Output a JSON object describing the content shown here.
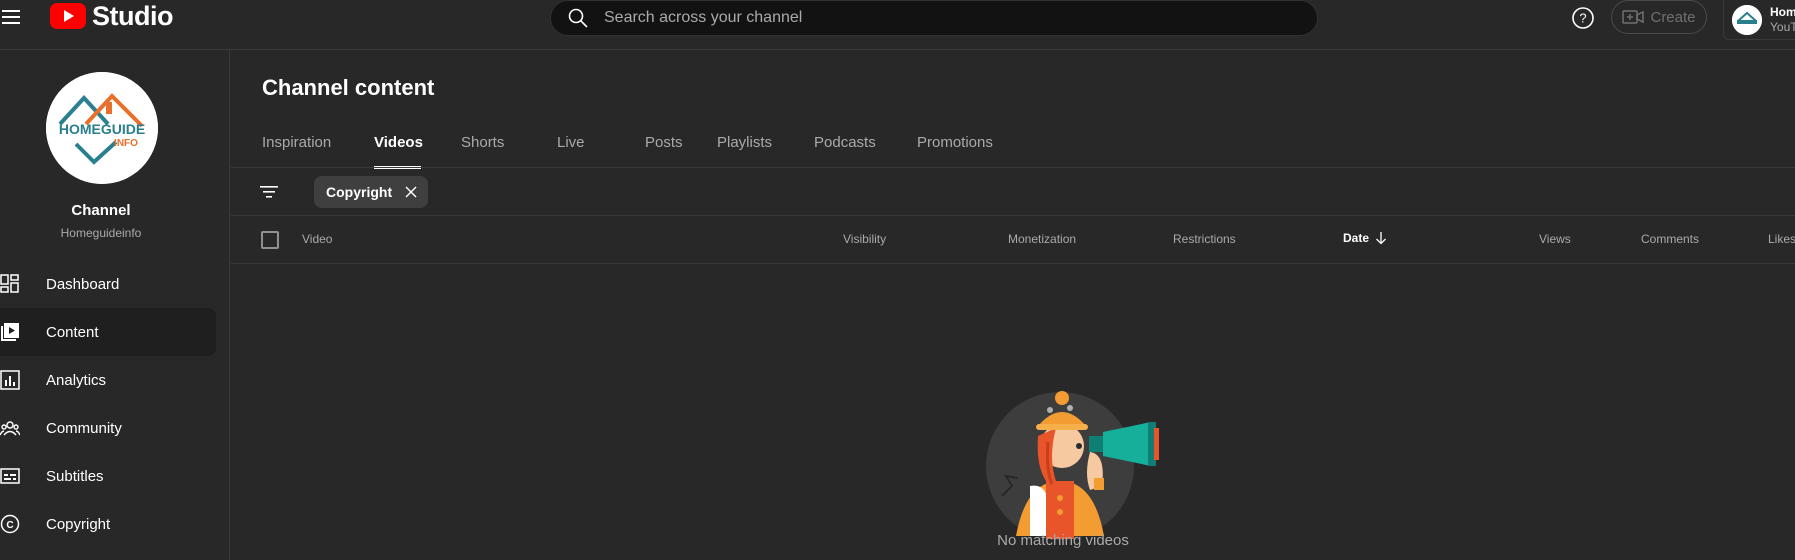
{
  "header": {
    "logo_text": "Studio",
    "search_placeholder": "Search across your channel",
    "create_label": "Create",
    "account": {
      "name": "Homeguideinfo",
      "subtitle": "YouTube"
    }
  },
  "sidebar": {
    "channel_label": "Channel",
    "channel_handle": "Homeguideinfo",
    "logo_text_main": "HOMEGUIDE",
    "logo_text_sub": "INFO",
    "items": [
      {
        "label": "Dashboard",
        "icon": "dashboard-icon"
      },
      {
        "label": "Content",
        "icon": "content-icon",
        "active": true
      },
      {
        "label": "Analytics",
        "icon": "analytics-icon"
      },
      {
        "label": "Community",
        "icon": "community-icon"
      },
      {
        "label": "Subtitles",
        "icon": "subtitles-icon"
      },
      {
        "label": "Copyright",
        "icon": "copyright-icon"
      }
    ]
  },
  "main": {
    "title": "Channel content",
    "tabs": [
      {
        "label": "Inspiration"
      },
      {
        "label": "Videos",
        "active": true
      },
      {
        "label": "Shorts"
      },
      {
        "label": "Live"
      },
      {
        "label": "Posts"
      },
      {
        "label": "Playlists"
      },
      {
        "label": "Podcasts"
      },
      {
        "label": "Promotions"
      }
    ],
    "filter_chip": "Copyright",
    "columns": {
      "video": "Video",
      "visibility": "Visibility",
      "monetization": "Monetization",
      "restrictions": "Restrictions",
      "date": "Date",
      "views": "Views",
      "comments": "Comments",
      "likes": "Likes (vs. dislikes)"
    },
    "empty_message": "No matching videos"
  },
  "colors": {
    "background": "#282828",
    "brand_red": "#ff0000",
    "illustration_orange": "#f39c32"
  }
}
